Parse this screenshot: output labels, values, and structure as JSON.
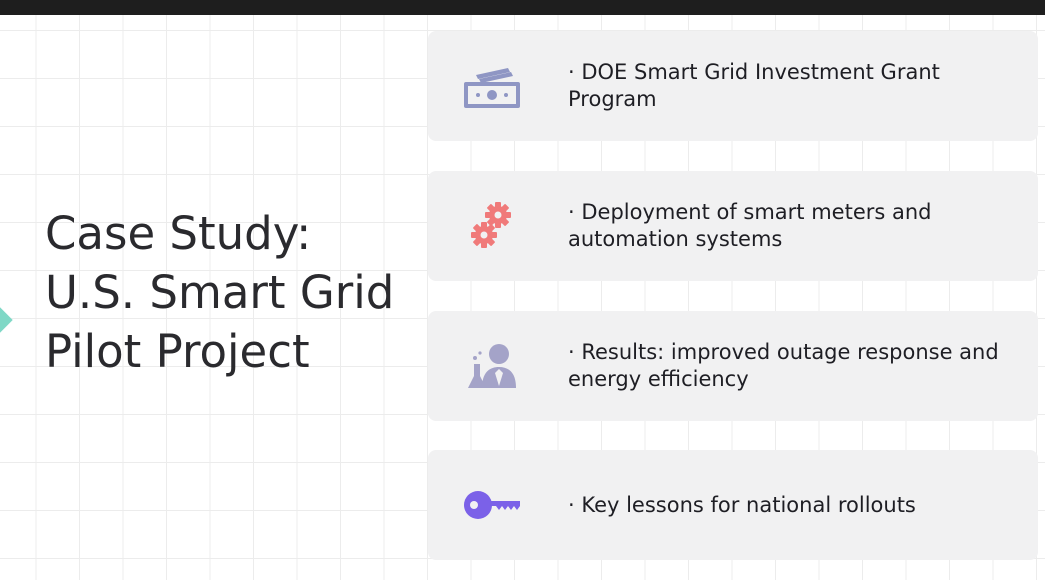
{
  "slide": {
    "title": "Case Study: U.S. Smart Grid Pilot Project"
  },
  "cards": [
    {
      "icon": "money-icon",
      "text": "· DOE Smart Grid Investment Grant Program",
      "color": "#8f96c4"
    },
    {
      "icon": "gears-icon",
      "text": "· Deployment of smart meters and automation systems",
      "color": "#f07a7a"
    },
    {
      "icon": "scientist-icon",
      "text": "· Results: improved outage response and energy efficiency",
      "color": "#a4a3c8"
    },
    {
      "icon": "key-icon",
      "text": "· Key lessons for national rollouts",
      "color": "#7b61e8"
    }
  ]
}
